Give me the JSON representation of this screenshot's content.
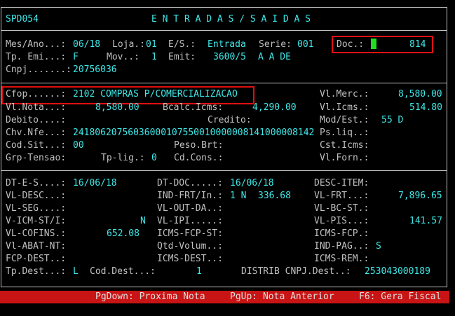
{
  "header": {
    "code": "SPD054",
    "title": "E N T R A D A S / S A I D A S"
  },
  "section1": {
    "mes_ano_label": "Mes/Ano...:",
    "mes_ano": "06/18",
    "loja_label": "Loja.:",
    "loja": "01",
    "es_label": "E/S.:",
    "es": "Entrada",
    "serie_label": "Serie:",
    "serie": "001",
    "doc_label": "Doc.:",
    "doc": "814",
    "tp_emi_label": "Tp. Emi...:",
    "tp_emi": "F",
    "mov_label": "Mov..:",
    "mov": "1",
    "emit_label": "Emit:",
    "emit": "3600/5",
    "emit_name": "A A DE",
    "cnpj_label": "Cnpj.......:",
    "cnpj": "20756036"
  },
  "section2": {
    "cfop_label": "Cfop......:",
    "cfop": "2102 COMPRAS P/COMERCIALIZACAO",
    "vl_merc_label": "Vl.Merc.:",
    "vl_merc": "8,580.00",
    "vl_nota_label": "Vl.Nota...:",
    "vl_nota": "8,580.00",
    "bcalc_label": "Bcalc.Icms:",
    "bcalc": "4,290.00",
    "vl_icms_label": "Vl.Icms.:",
    "vl_icms": "514.80",
    "debito_label": "Debito....:",
    "credito_label": "Credito:",
    "mod_est_label": "Mod/Est.:",
    "mod_est": "55 D",
    "chv_label": "Chv.Nfe...:",
    "chv": "24180620756036000107550010000008141000008142",
    "ps_liq_label": "Ps.liq..:",
    "cod_sit_label": "Cod.Sit...:",
    "cod_sit": "00",
    "peso_brt_label": "Peso.Brt:",
    "cst_icms_label": "Cst.Icms:",
    "grp_tensao_label": "Grp-Tensao:",
    "tp_lig_label": "Tp-lig.:",
    "tp_lig": "0",
    "cd_cons_label": "Cd.Cons.:",
    "vl_forn_label": "Vl.Forn.:"
  },
  "section3": {
    "dt_es_label": "DT-E-S....:",
    "dt_es": "16/06/18",
    "dt_doc_label": "DT-DOC.....:",
    "dt_doc": "16/06/18",
    "desc_item_label": "DESC-ITEM:",
    "vl_desc_label": "VL-DESC...:",
    "ind_frt_label": "IND-FRT/In.:",
    "ind_frt": "1 N",
    "ind_frt_val": "336.68",
    "vl_frt_label": "VL-FRT...:",
    "vl_frt": "7,896.65",
    "vl_seg_label": "VL-SEG....:",
    "vl_out_da_label": "VL-OUT-DA..:",
    "vl_bc_st_label": "VL-BC-ST.:",
    "v_icm_st_label": "V-ICM-ST/I:",
    "v_icm_st": "N",
    "vl_ipi_label": "VL-IPI.....:",
    "vl_pis_label": "VL-PIS...:",
    "vl_pis": "141.57",
    "vl_cofins_label": "VL-COFINS.:",
    "vl_cofins": "652.08",
    "icms_fcp_st_label": "ICMS-FCP-ST:",
    "icms_fcp_label": "ICMS-FCP.:",
    "vl_abat_label": "Vl-ABAT-NT:",
    "qtd_volum_label": "Qtd-Volum..:",
    "ind_pag_label": "IND-PAG..:",
    "ind_pag": "S",
    "fcp_dest_label": "FCP-DEST..:",
    "icms_dest_label": "ICMS-DEST..:",
    "icms_rem_label": "ICMS-REM.:",
    "tp_dest_label": "Tp.Dest...:",
    "tp_dest": "L",
    "cod_dest_label": "Cod.Dest...:",
    "cod_dest": "1",
    "distrib_label": "DISTRIB CNPJ.Dest..:",
    "distrib": "253043000189"
  },
  "footer": {
    "pgdown": "PgDown: Proxima Nota",
    "pgup": "PgUp: Nota Anterior",
    "f6": "F6: Gera Fiscal"
  },
  "colors": {
    "background": "#000000",
    "label": "#c0c0c0",
    "value": "#3ee8e8",
    "highlight": "#e01010",
    "footer": "#c81414"
  }
}
